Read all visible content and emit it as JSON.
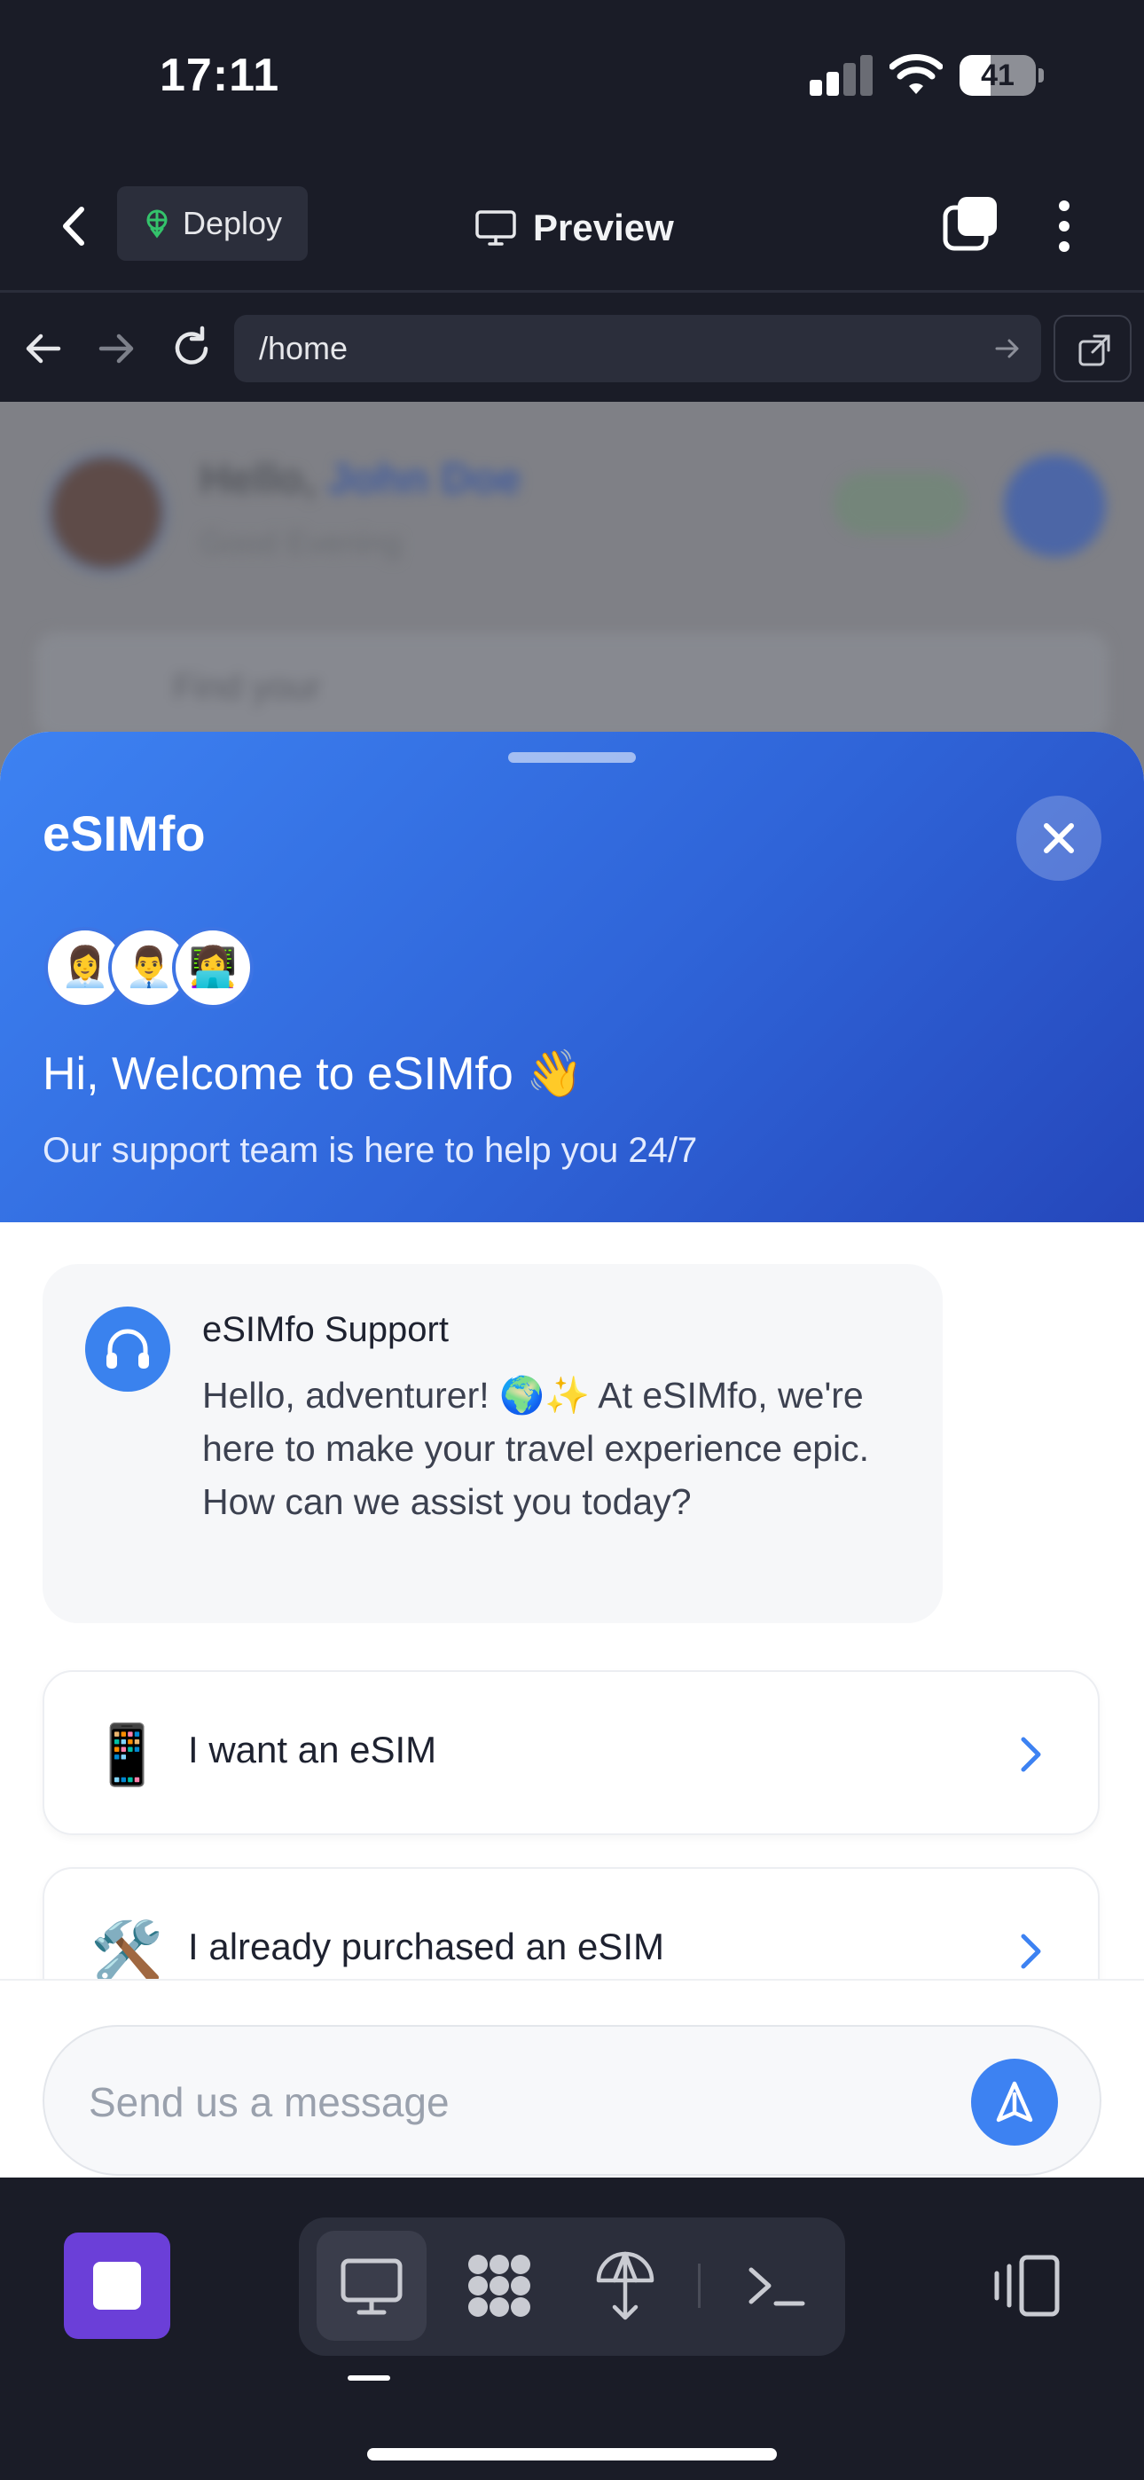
{
  "status_bar": {
    "time": "17:11",
    "battery": "41",
    "battery_level": 0.41
  },
  "header": {
    "deploy_label": "Deploy",
    "title": "Preview"
  },
  "url_bar": {
    "url": "/home"
  },
  "web_page": {
    "greeting": "Hello,",
    "user_name": "John Doe",
    "subtitle": "Good Evening",
    "search_placeholder": "Find your"
  },
  "chat": {
    "brand": "eSIMfo",
    "avatars": [
      "👩‍💼",
      "👨‍💼",
      "👩‍💻"
    ],
    "welcome_title": "Hi, Welcome to eSIMfo 👋",
    "welcome_subtitle": "Our support team is here to help you 24/7",
    "message": {
      "sender": "eSIMfo Support",
      "body": "Hello, adventurer! 🌍✨ At eSIMfo, we're here to make your travel experience epic. How can we assist you today?"
    },
    "options": [
      {
        "icon": "📱",
        "label": "I want an eSIM"
      },
      {
        "icon": "🛠️",
        "label": "I already purchased an eSIM"
      }
    ],
    "composer_placeholder": "Send us a message"
  },
  "colors": {
    "app_bg": "#1a1c27",
    "accent_blue": "#3d82f2",
    "hero_gradient_end": "#2547bb",
    "stop_purple": "#6b3fd8",
    "deploy_green": "#34c36b"
  }
}
